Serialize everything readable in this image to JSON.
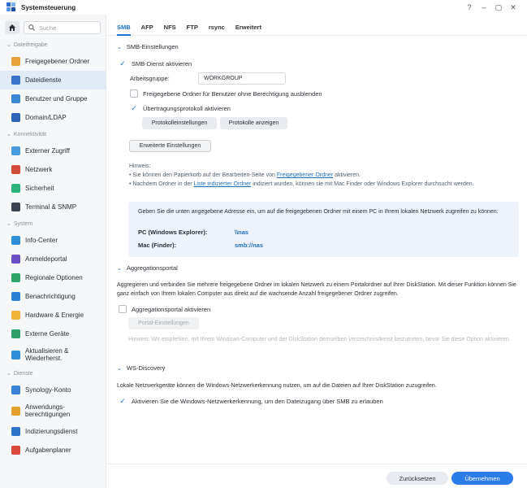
{
  "window": {
    "title": "Systemsteuerung",
    "controls": [
      "?",
      "–",
      "▢",
      "✕"
    ]
  },
  "sidebar": {
    "search_placeholder": "Suche",
    "sections": [
      {
        "label": "Dateifreigabe",
        "items": [
          {
            "label": "Freigegebener Ordner",
            "icon": "folder-icon",
            "color": "#e8a23b"
          },
          {
            "label": "Dateidienste",
            "icon": "file-services-icon",
            "color": "#3a73c9",
            "active": true
          },
          {
            "label": "Benutzer und Gruppe",
            "icon": "users-icon",
            "color": "#3a86d4"
          },
          {
            "label": "Domain/LDAP",
            "icon": "domain-icon",
            "color": "#2e63b8"
          }
        ]
      },
      {
        "label": "Konnektivität",
        "items": [
          {
            "label": "Externer Zugriff",
            "icon": "external-access-icon",
            "color": "#4b9be0"
          },
          {
            "label": "Netzwerk",
            "icon": "network-icon",
            "color": "#d24a3c"
          },
          {
            "label": "Sicherheit",
            "icon": "shield-icon",
            "color": "#2eb37a"
          },
          {
            "label": "Terminal & SNMP",
            "icon": "terminal-icon",
            "color": "#3b4350"
          }
        ]
      },
      {
        "label": "System",
        "items": [
          {
            "label": "Info-Center",
            "icon": "info-icon",
            "color": "#2f8ed8"
          },
          {
            "label": "Anmeldeportal",
            "icon": "login-portal-icon",
            "color": "#6b4fc4"
          },
          {
            "label": "Regionale Optionen",
            "icon": "globe-icon",
            "color": "#2ea66b"
          },
          {
            "label": "Benachrichtigung",
            "icon": "notification-icon",
            "color": "#2e7fd6"
          },
          {
            "label": "Hardware & Energie",
            "icon": "bulb-icon",
            "color": "#f0b43a"
          },
          {
            "label": "Externe Geräte",
            "icon": "external-devices-icon",
            "color": "#2e9e6a"
          },
          {
            "label": "Aktualisieren & Wiederherst.",
            "icon": "update-icon",
            "color": "#2f8ed8"
          }
        ]
      },
      {
        "label": "Dienste",
        "items": [
          {
            "label": "Synology-Konto",
            "icon": "account-icon",
            "color": "#3b82d6"
          },
          {
            "label": "Anwendungs-berechtigungen",
            "icon": "app-permissions-icon",
            "color": "#e3a02e"
          },
          {
            "label": "Indizierungsdienst",
            "icon": "indexing-icon",
            "color": "#2e72c9"
          },
          {
            "label": "Aufgabenplaner",
            "icon": "calendar-icon",
            "color": "#d94a3c"
          }
        ]
      }
    ]
  },
  "tabs": [
    "SMB",
    "AFP",
    "NFS",
    "FTP",
    "rsync",
    "Erweitert"
  ],
  "smb": {
    "heading": "SMB-Einstellungen",
    "enable_label": "SMB-Dienst aktivieren",
    "workgroup_label": "Arbeitsgruppe:",
    "workgroup_value": "WORKGROUP",
    "hide_folders_label": "Freigegebene Ordner für Benutzer ohne Berechtigung ausblenden",
    "transfer_log_label": "Übertragungsprotokoll aktivieren",
    "protocol_settings_btn": "Protokolleinstellungen",
    "show_logs_btn": "Protokolle anzeigen",
    "advanced_btn": "Erweiterte Einstellungen",
    "hint_title": "Hinweis:",
    "hint1_pre": "Sie können den Papierkorb auf der Bearbeiten-Seite von ",
    "hint1_link": "Freigegebener Ordner",
    "hint1_post": " aktivieren.",
    "hint2_pre": "Nachdem Ordner in der ",
    "hint2_link": "Liste indizierter Ordner",
    "hint2_post": " indiziert wurden, können sie mit Mac Finder oder Windows Explorer durchsucht werden.",
    "info_text": "Geben Sie die unten angegebene Adresse ein, um auf die freigegebenen Ordner mit einem PC in Ihrem lokalen Netzwerk zugreifen zu können:",
    "pc_label": "PC (Windows Explorer):",
    "pc_value": "\\\\nas",
    "mac_label": "Mac (Finder):",
    "mac_value": "smb://nas"
  },
  "aggregation": {
    "heading": "Aggregationsportal",
    "description": "Aggregieren und verbinden Sie mehrere freigegebene Ordner im lokalen Netzwerk zu einem Portalordner auf Ihrer DiskStation. Mit dieser Funktion können Sie ganz einfach von Ihrem lokalen Computer aus direkt auf die wachsende Anzahl freigegebener Ordner zugreifen.",
    "enable_label": "Aggregationsportal aktivieren",
    "settings_btn": "Portal-Einstellungen",
    "hint": "Hinweis: Wir empfehlen, mit Ihrem Windows-Computer und der DiskStation demselben Verzeichnisdienst beizutreten, bevor Sie diese Option aktivieren."
  },
  "ws_discovery": {
    "heading": "WS-Discovery",
    "description": "Lokale Netzwerkgeräte können die Windows-Netzwerkerkennung nutzen, um auf die Dateien auf Ihrer DiskStation zuzugreifen.",
    "enable_label": "Aktivieren Sie die Windows-Netzwerkerkennung, um den Dateizugang über SMB zu erlauben"
  },
  "footer": {
    "reset_label": "Zurücksetzen",
    "apply_label": "Übernehmen"
  },
  "colors": {
    "accent": "#1f74d6",
    "primary_button": "#2b7de9",
    "active_nav": "#e1ebf7"
  }
}
